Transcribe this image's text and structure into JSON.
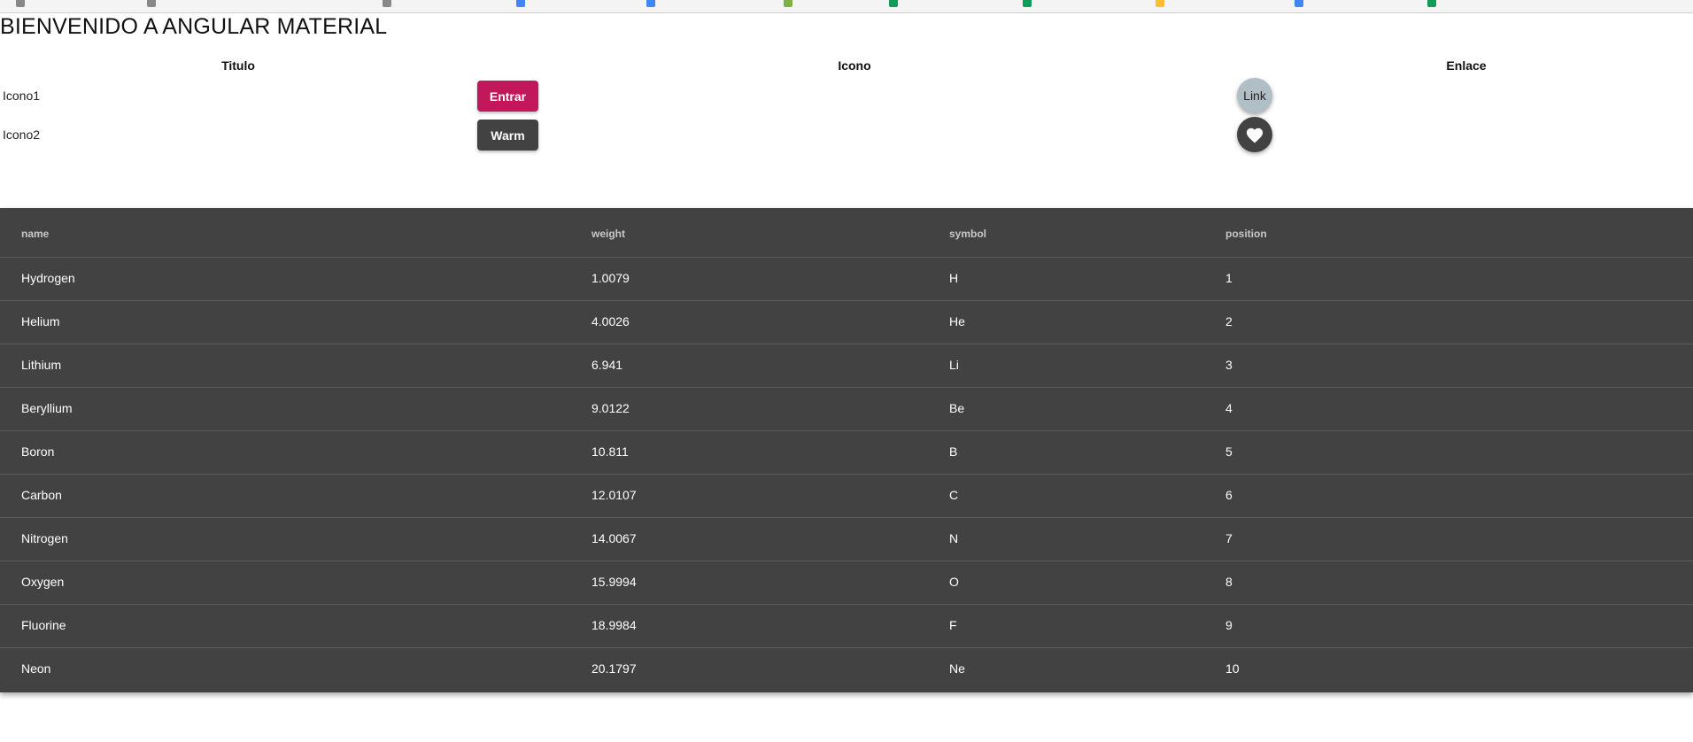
{
  "header": {
    "title": "BIENVENIDO A ANGULAR MATERIAL"
  },
  "grid": {
    "columns": [
      "Titulo",
      "Icono",
      "Enlace"
    ],
    "rows": [
      {
        "label": "Icono1",
        "button": "Entrar",
        "link": "Link"
      },
      {
        "label": "Icono2",
        "button": "Warm",
        "link_icon": "heart-icon"
      }
    ]
  },
  "table": {
    "columns": [
      "name",
      "weight",
      "symbol",
      "position"
    ],
    "rows": [
      {
        "name": "Hydrogen",
        "weight": "1.0079",
        "symbol": "H",
        "position": "1"
      },
      {
        "name": "Helium",
        "weight": "4.0026",
        "symbol": "He",
        "position": "2"
      },
      {
        "name": "Lithium",
        "weight": "6.941",
        "symbol": "Li",
        "position": "3"
      },
      {
        "name": "Beryllium",
        "weight": "9.0122",
        "symbol": "Be",
        "position": "4"
      },
      {
        "name": "Boron",
        "weight": "10.811",
        "symbol": "B",
        "position": "5"
      },
      {
        "name": "Carbon",
        "weight": "12.0107",
        "symbol": "C",
        "position": "6"
      },
      {
        "name": "Nitrogen",
        "weight": "14.0067",
        "symbol": "N",
        "position": "7"
      },
      {
        "name": "Oxygen",
        "weight": "15.9994",
        "symbol": "O",
        "position": "8"
      },
      {
        "name": "Fluorine",
        "weight": "18.9984",
        "symbol": "F",
        "position": "9"
      },
      {
        "name": "Neon",
        "weight": "20.1797",
        "symbol": "Ne",
        "position": "10"
      }
    ]
  },
  "colors": {
    "primary": "#c2185b",
    "warn_button": "#424242",
    "link_fab": "#b0bec5",
    "table_background": "#424242"
  }
}
